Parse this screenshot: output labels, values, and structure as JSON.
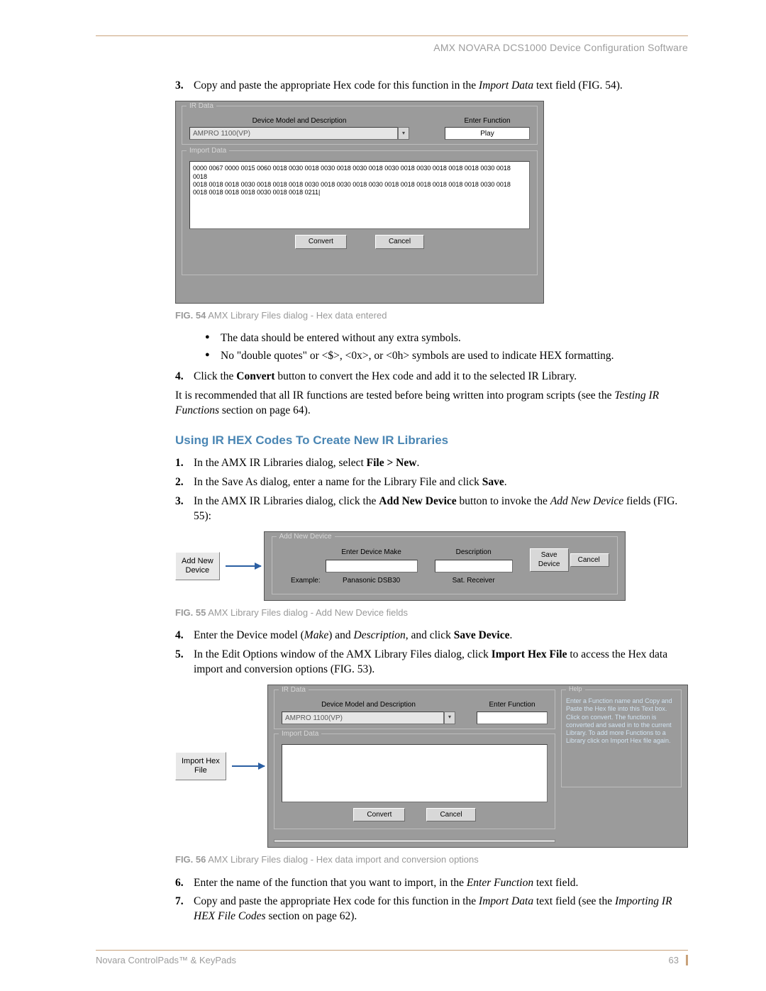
{
  "header": {
    "running": "AMX NOVARA DCS1000 Device Configuration Software"
  },
  "step3": {
    "num": "3.",
    "text_a": "Copy and paste the appropriate Hex code for this function in the ",
    "text_b": "Import Data",
    "text_c": " text field (FIG. 54)."
  },
  "fig54": {
    "ir_data_title": "IR Data",
    "device_label": "Device Model and Description",
    "device_value": "AMPRO 1100(VP)",
    "func_label": "Enter Function",
    "func_value": "Play",
    "import_title": "Import Data",
    "hex": "0000 0067 0000 0015 0060 0018 0030 0018 0030 0018 0030 0018 0030 0018 0030 0018 0018 0018 0030 0018 0018\n0018 0018 0018 0030 0018 0018 0018 0030 0018 0030 0018 0030 0018 0018 0018 0018 0018 0018 0030 0018\n0018 0018 0018 0018 0030 0018 0018 0211|",
    "convert": "Convert",
    "cancel": "Cancel",
    "caption_n": "FIG. 54",
    "caption_t": " AMX Library Files dialog - Hex data entered"
  },
  "bullets54": {
    "b1": "The data should be entered without any extra symbols.",
    "b2": "No \"double quotes\" or <$>, <0x>, or <0h> symbols are used to indicate HEX formatting."
  },
  "step4": {
    "num": "4.",
    "a": "Click the ",
    "b": "Convert",
    "c": " button to convert the Hex code and add it to the selected IR Library."
  },
  "rec": {
    "a": "It is recommended that all IR functions are tested before being written into program scripts (see the ",
    "b": "Testing IR Functions",
    "c": " section on page 64)."
  },
  "section": "Using IR HEX Codes To Create New IR Libraries",
  "s1": {
    "num": "1.",
    "a": "In the AMX IR Libraries dialog, select ",
    "b": "File > New",
    "c": "."
  },
  "s2": {
    "num": "2.",
    "a": "In the Save As dialog, enter a name for the Library File and click ",
    "b": "Save",
    "c": "."
  },
  "s3": {
    "num": "3.",
    "a": "In the AMX IR Libraries dialog, click the ",
    "b": "Add New Device",
    "c": " button to invoke the ",
    "d": "Add New Device",
    "e": " fields (FIG. 55):"
  },
  "fig55": {
    "callout": "Add New\nDevice",
    "group": "Add New Device",
    "make_label": "Enter Device Make",
    "desc_label": "Description",
    "save": "Save\nDevice",
    "cancel": "Cancel",
    "example_lbl": "Example:",
    "example_make": "Panasonic DSB30",
    "example_desc": "Sat. Receiver",
    "caption_n": "FIG. 55",
    "caption_t": " AMX Library Files dialog - Add New Device fields"
  },
  "s4": {
    "num": "4.",
    "a": "Enter the Device model (",
    "b": "Make",
    "c": ") and ",
    "d": "Description",
    "e": ", and click ",
    "f": "Save Device",
    "g": "."
  },
  "s5": {
    "num": "5.",
    "a": "In the Edit Options window of the AMX Library Files dialog, click ",
    "b": "Import Hex File",
    "c": " to access the Hex data import and conversion options (FIG. 53)."
  },
  "fig56": {
    "callout": "Import Hex\nFile",
    "ir_data": "IR Data",
    "device_label": "Device Model and Description",
    "device_value": "AMPRO 1100(VP)",
    "func_label": "Enter Function",
    "import": "Import Data",
    "help_title": "Help",
    "help_text": "Enter a Function name and Copy and Paste the Hex file into this Text box. Click on convert. The function is converted and saved in to the current Library. To add more Functions to a Library click on Import Hex file again.",
    "convert": "Convert",
    "cancel": "Cancel",
    "caption_n": "FIG. 56",
    "caption_t": " AMX Library Files dialog - Hex data import and conversion options"
  },
  "s6": {
    "num": "6.",
    "a": "Enter the name of the function that you want to import, in the ",
    "b": "Enter Function",
    "c": " text field."
  },
  "s7": {
    "num": "7.",
    "a": "Copy and paste the appropriate Hex code for this function in the ",
    "b": "Import Data",
    "c": " text field (see the ",
    "d": "Importing IR HEX File Codes",
    "e": " section on page 62)."
  },
  "footer": {
    "left": "Novara ControlPads™ & KeyPads",
    "page": "63"
  }
}
